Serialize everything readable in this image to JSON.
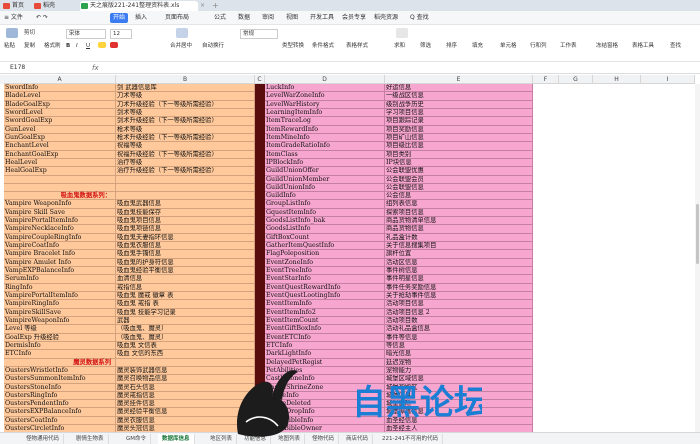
{
  "titlebar": {
    "tabs": [
      {
        "label": "首页",
        "color": "#e84a3a"
      },
      {
        "label": "稻壳",
        "color": "#e84a3a"
      },
      {
        "label": "天之痕版221-241整理资料表.xls",
        "color": "#2ea44f"
      }
    ],
    "add_symbol": "+",
    "close_symbol": "×"
  },
  "menu": {
    "file_label": "≡ 文件",
    "items": [
      "开始",
      "插入",
      "页面布局",
      "公式",
      "数据",
      "审阅",
      "视图",
      "开发工具",
      "会员专享",
      "稻壳资源"
    ],
    "active": "开始",
    "search_label": "Q 查找"
  },
  "ribbon": {
    "cut": "剪切",
    "paste": "粘贴",
    "copy": "复制",
    "format_painter": "格式刷",
    "font_name": "宋体",
    "font_size": "12",
    "bold": "B",
    "italic": "I",
    "underline": "U",
    "merge": "合并居中",
    "wrap": "自动换行",
    "number_format": "常规",
    "convert": "类型转换",
    "cond_format": "条件格式",
    "cell_style": "表格样式",
    "sum": "求和",
    "filter": "筛选",
    "sort": "排序",
    "fill": "填充",
    "cell": "单元格",
    "rowcol": "行和列",
    "worksheet": "工作表",
    "freeze": "冻结窗格",
    "table_tools": "表格工具",
    "find": "查找"
  },
  "formula_bar": {
    "cell_ref": "E178",
    "fx": "fx",
    "value": ""
  },
  "columns": [
    "A",
    "B",
    "C",
    "D",
    "E",
    "F",
    "G",
    "H",
    "I"
  ],
  "rows": [
    [
      "SwordInfo",
      "剑 武器信息库",
      "LuckInfo",
      "好运信息"
    ],
    [
      "BladeLevel",
      "刀术等级",
      "LevelWarZoneInfo",
      "一级战区信息"
    ],
    [
      "BladeGoalExp",
      "刀术升级经验（下一等级所需经验）",
      "LevelWarHistory",
      "级别战争历史"
    ],
    [
      "SwordLevel",
      "  剑术等级",
      "LearningItemInfo",
      "学习项目信息"
    ],
    [
      "SwordGoalExp",
      "剑术升级经验（下一等级所需经验）",
      "ItemTraceLog",
      "项目跟踪记录"
    ],
    [
      "GunLevel",
      "枪术等级",
      "ItemRewardInfo",
      "项目奖励信息"
    ],
    [
      "GunGoalExp",
      "枪术升级经验（下一等级所需经验）",
      "ItemMineInfo",
      "项目矿山信息"
    ],
    [
      "EnchantLevel",
      "祝福等级",
      "ItemGradeRatioInfo",
      "项目级比信息"
    ],
    [
      "EnchantGoalExp",
      "祝福升级经验（下一等级所需经验）",
      "ItemClass",
      "项目类别"
    ],
    [
      "HealLevel",
      "治疗等级",
      "IPBlockInfo",
      "IP块信息"
    ],
    [
      "HealGoalExp",
      "治疗升级经验（下一等级所需经验）",
      "GuildUnionOffer",
      "公会联盟优惠"
    ],
    [
      "",
      "",
      "GuildUnionMember",
      "公会联盟会员"
    ],
    [
      "",
      "",
      "GuildUnionInfo",
      "公会联盟信息"
    ],
    [
      "@吸血鬼数据系列：",
      "",
      "GuildInfo",
      "公会信息"
    ],
    [
      "Vampire WeaponInfo",
      "吸血鬼武器信息",
      " GroupListInfo",
      "组列表信息"
    ],
    [
      "Vampire Skill Save",
      "吸血鬼技能保存",
      "GquestItemInfo",
      "探索项目信息"
    ],
    [
      "VampirePortalItemInfo",
      "吸血鬼项目信息",
      "GoodsListInfo_bak",
      "商品货物清单信息"
    ],
    [
      "VampireNecklaceInfo",
      "吸血鬼项链信息",
      "GoodsListInfo",
      "商品货物信息"
    ],
    [
      "VampireCoupleRingInfo",
      "吸血鬼夫妻指环信息",
      "GiftBoxCount",
      "礼品盒计数"
    ],
    [
      "VampireCoatInfo",
      "吸血鬼衣服信息",
      "GatherItemQuestInfo",
      "关于信息搜集项目"
    ],
    [
      "Vampire Bracelet Info",
      "吸血鬼手镯信息",
      "FlagPoleposition",
      "旗杆位置"
    ],
    [
      "Vampire Amulet Info",
      "吸血鬼的护身符信息",
      "EventZoneInfo",
      "活动区信息"
    ],
    [
      "VampEXPBalanceInfo",
      "吸血鬼经验平衡信息",
      "EventTreeInfo",
      "事件树信息"
    ],
    [
      "SerumInfo",
      "血清信息",
      "EventStarInfo",
      "事件明星信息"
    ],
    [
      "RingInfo",
      "戒指信息",
      "EventQuestRewardInfo",
      "事件任务奖励信息"
    ],
    [
      "VampirePortalItemInfo",
      "吸血鬼 魔戒 徽章 表",
      "EventQuestLootingInfo",
      "关于抢劫事件信息"
    ],
    [
      "VampireRingInfo",
      "吸血鬼 戒指 表",
      "EventItemInfo",
      "活动项目信息"
    ],
    [
      "VampireSkillSave",
      "吸血鬼 技能学习记录",
      "EventItemInfo2",
      "活动项目信息 2"
    ],
    [
      "VampireWeaponInfo",
      "武器",
      "EventItemCount",
      "活动项目数"
    ],
    [
      "Level 等级",
      "（吸血鬼、魔灵）",
      "EventGiftBoxInfo",
      "活动礼品盒信息"
    ],
    [
      "GoalExp 升级经验",
      "（吸血鬼、魔灵）",
      " EventETCInfo",
      "事件等信息"
    ],
    [
      "DermisInfo",
      "吸血鬼 文信表",
      "ETCInfo",
      "等信息"
    ],
    [
      "ETCInfo",
      "吸血 文信的东西",
      "DarkLightInfo",
      "暗光信息"
    ],
    [
      "@魔灵数据系列",
      "",
      "DelayedPetRegist",
      "延迟宠物"
    ],
    [
      "OustersWristletInfo",
      "魔灵装饰武器信息",
      "PetAbilities",
      "宠物能力"
    ],
    [
      "OustersSummonItemInfo",
      "魔灵召唤物品信息",
      "CastleZoneInfo",
      "城堡区域信息"
    ],
    [
      "OustersStoneInfo",
      "魔灵石头信息",
      "CastleShrineZone",
      "城堡神殿区"
    ],
    [
      "OustersRingInfo",
      "魔灵戒指信息",
      "CastleInfo",
      "城堡信息"
    ],
    [
      "OustersPendentInfo",
      "魔灵挂件信息",
      "CastleDeleted",
      "城堡删除"
    ],
    [
      "OustersEXPBalanceInfo",
      "魔灵经验平衡信息",
      "CastleDropInfo",
      "城堡掉落信息"
    ],
    [
      "OustersCoatInfo",
      "魔灵衣服信息",
      "BloodBibleInfo",
      "血圣经信息"
    ],
    [
      "OustersCircletInfo",
      "魔灵头冠信息",
      "BloodBibleOwner",
      "血圣经主人"
    ]
  ],
  "sheets": [
    "怪物通用代码",
    "剧情生物表",
    "GM命令",
    "数据库信息",
    "地区列表",
    "功能信息",
    "地图列表",
    "怪物代码",
    "商店代码",
    "221-241不可用的代码"
  ],
  "active_sheet": "数据库信息",
  "watermark": {
    "text": "自黑论坛",
    "color_dark": "#1a7fd4",
    "color_light": "#39a8e8"
  }
}
